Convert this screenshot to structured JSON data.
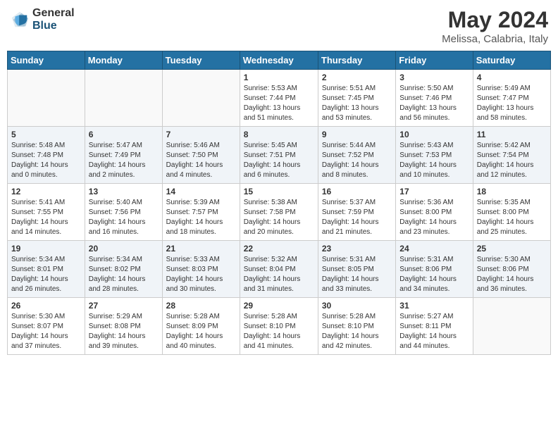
{
  "logo": {
    "general": "General",
    "blue": "Blue"
  },
  "header": {
    "title": "May 2024",
    "subtitle": "Melissa, Calabria, Italy"
  },
  "weekdays": [
    "Sunday",
    "Monday",
    "Tuesday",
    "Wednesday",
    "Thursday",
    "Friday",
    "Saturday"
  ],
  "weeks": [
    [
      {
        "day": "",
        "info": ""
      },
      {
        "day": "",
        "info": ""
      },
      {
        "day": "",
        "info": ""
      },
      {
        "day": "1",
        "info": "Sunrise: 5:53 AM\nSunset: 7:44 PM\nDaylight: 13 hours\nand 51 minutes."
      },
      {
        "day": "2",
        "info": "Sunrise: 5:51 AM\nSunset: 7:45 PM\nDaylight: 13 hours\nand 53 minutes."
      },
      {
        "day": "3",
        "info": "Sunrise: 5:50 AM\nSunset: 7:46 PM\nDaylight: 13 hours\nand 56 minutes."
      },
      {
        "day": "4",
        "info": "Sunrise: 5:49 AM\nSunset: 7:47 PM\nDaylight: 13 hours\nand 58 minutes."
      }
    ],
    [
      {
        "day": "5",
        "info": "Sunrise: 5:48 AM\nSunset: 7:48 PM\nDaylight: 14 hours\nand 0 minutes."
      },
      {
        "day": "6",
        "info": "Sunrise: 5:47 AM\nSunset: 7:49 PM\nDaylight: 14 hours\nand 2 minutes."
      },
      {
        "day": "7",
        "info": "Sunrise: 5:46 AM\nSunset: 7:50 PM\nDaylight: 14 hours\nand 4 minutes."
      },
      {
        "day": "8",
        "info": "Sunrise: 5:45 AM\nSunset: 7:51 PM\nDaylight: 14 hours\nand 6 minutes."
      },
      {
        "day": "9",
        "info": "Sunrise: 5:44 AM\nSunset: 7:52 PM\nDaylight: 14 hours\nand 8 minutes."
      },
      {
        "day": "10",
        "info": "Sunrise: 5:43 AM\nSunset: 7:53 PM\nDaylight: 14 hours\nand 10 minutes."
      },
      {
        "day": "11",
        "info": "Sunrise: 5:42 AM\nSunset: 7:54 PM\nDaylight: 14 hours\nand 12 minutes."
      }
    ],
    [
      {
        "day": "12",
        "info": "Sunrise: 5:41 AM\nSunset: 7:55 PM\nDaylight: 14 hours\nand 14 minutes."
      },
      {
        "day": "13",
        "info": "Sunrise: 5:40 AM\nSunset: 7:56 PM\nDaylight: 14 hours\nand 16 minutes."
      },
      {
        "day": "14",
        "info": "Sunrise: 5:39 AM\nSunset: 7:57 PM\nDaylight: 14 hours\nand 18 minutes."
      },
      {
        "day": "15",
        "info": "Sunrise: 5:38 AM\nSunset: 7:58 PM\nDaylight: 14 hours\nand 20 minutes."
      },
      {
        "day": "16",
        "info": "Sunrise: 5:37 AM\nSunset: 7:59 PM\nDaylight: 14 hours\nand 21 minutes."
      },
      {
        "day": "17",
        "info": "Sunrise: 5:36 AM\nSunset: 8:00 PM\nDaylight: 14 hours\nand 23 minutes."
      },
      {
        "day": "18",
        "info": "Sunrise: 5:35 AM\nSunset: 8:00 PM\nDaylight: 14 hours\nand 25 minutes."
      }
    ],
    [
      {
        "day": "19",
        "info": "Sunrise: 5:34 AM\nSunset: 8:01 PM\nDaylight: 14 hours\nand 26 minutes."
      },
      {
        "day": "20",
        "info": "Sunrise: 5:34 AM\nSunset: 8:02 PM\nDaylight: 14 hours\nand 28 minutes."
      },
      {
        "day": "21",
        "info": "Sunrise: 5:33 AM\nSunset: 8:03 PM\nDaylight: 14 hours\nand 30 minutes."
      },
      {
        "day": "22",
        "info": "Sunrise: 5:32 AM\nSunset: 8:04 PM\nDaylight: 14 hours\nand 31 minutes."
      },
      {
        "day": "23",
        "info": "Sunrise: 5:31 AM\nSunset: 8:05 PM\nDaylight: 14 hours\nand 33 minutes."
      },
      {
        "day": "24",
        "info": "Sunrise: 5:31 AM\nSunset: 8:06 PM\nDaylight: 14 hours\nand 34 minutes."
      },
      {
        "day": "25",
        "info": "Sunrise: 5:30 AM\nSunset: 8:06 PM\nDaylight: 14 hours\nand 36 minutes."
      }
    ],
    [
      {
        "day": "26",
        "info": "Sunrise: 5:30 AM\nSunset: 8:07 PM\nDaylight: 14 hours\nand 37 minutes."
      },
      {
        "day": "27",
        "info": "Sunrise: 5:29 AM\nSunset: 8:08 PM\nDaylight: 14 hours\nand 39 minutes."
      },
      {
        "day": "28",
        "info": "Sunrise: 5:28 AM\nSunset: 8:09 PM\nDaylight: 14 hours\nand 40 minutes."
      },
      {
        "day": "29",
        "info": "Sunrise: 5:28 AM\nSunset: 8:10 PM\nDaylight: 14 hours\nand 41 minutes."
      },
      {
        "day": "30",
        "info": "Sunrise: 5:28 AM\nSunset: 8:10 PM\nDaylight: 14 hours\nand 42 minutes."
      },
      {
        "day": "31",
        "info": "Sunrise: 5:27 AM\nSunset: 8:11 PM\nDaylight: 14 hours\nand 44 minutes."
      },
      {
        "day": "",
        "info": ""
      }
    ]
  ]
}
